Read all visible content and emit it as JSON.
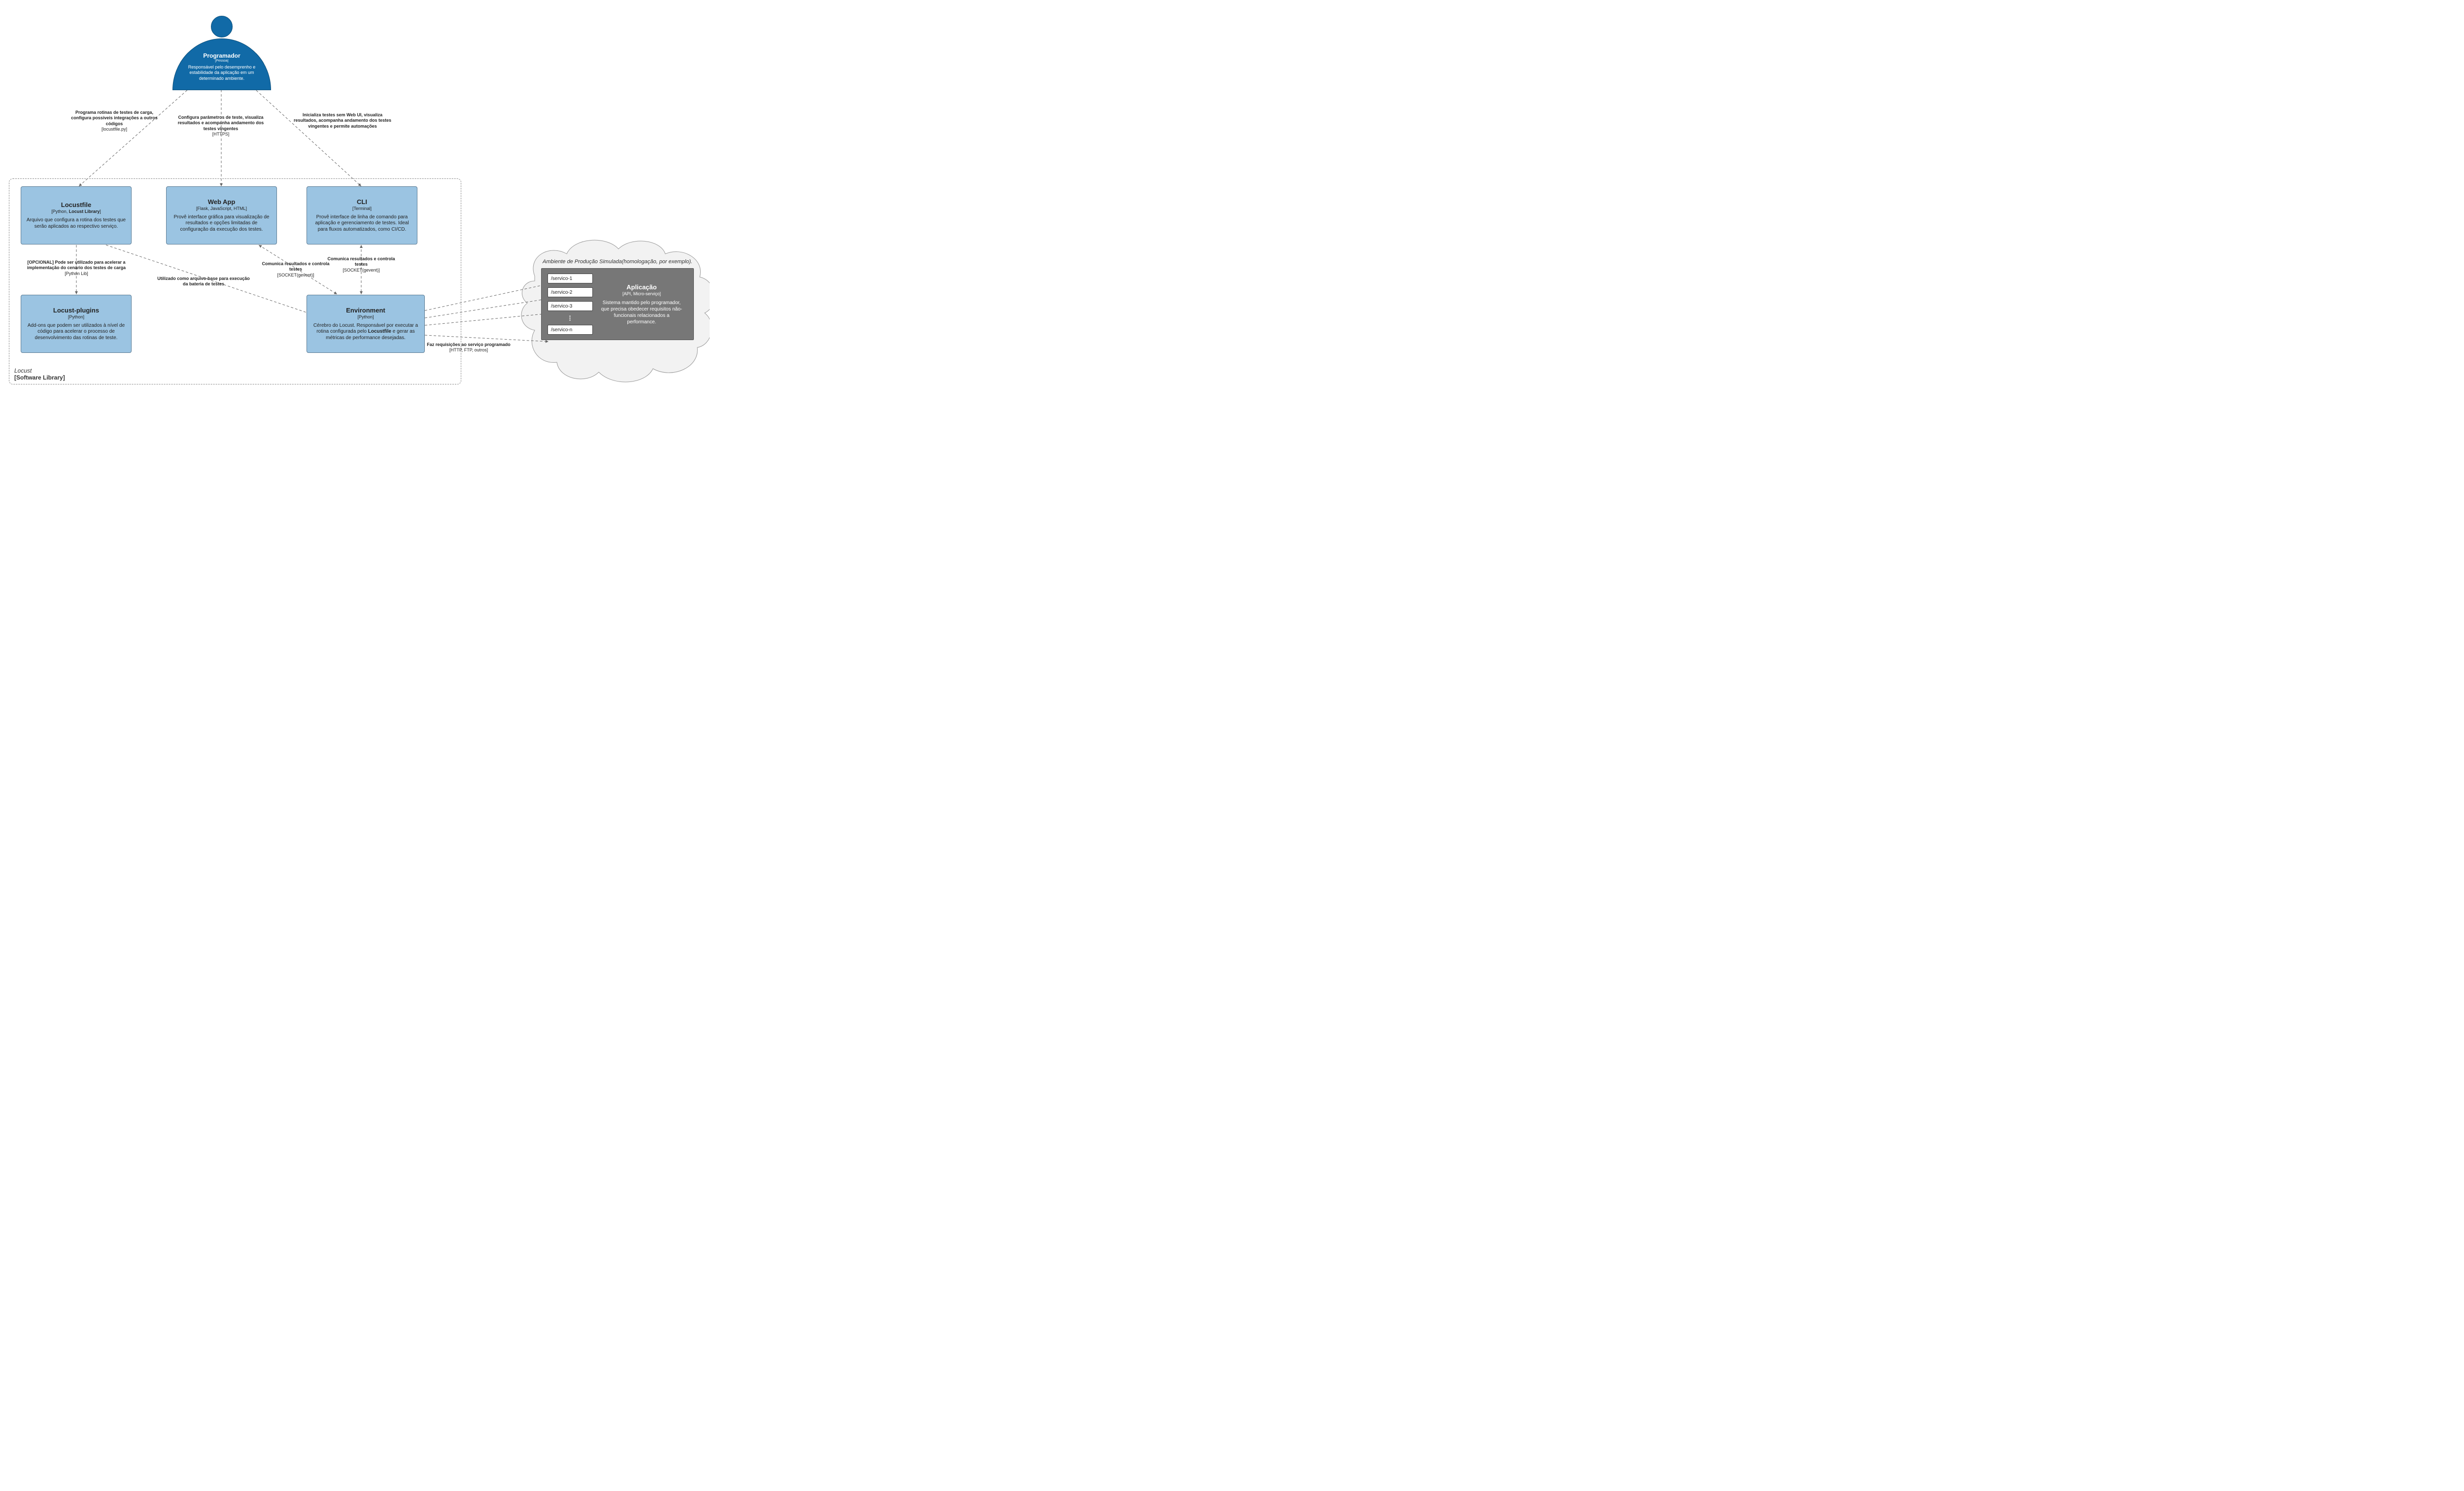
{
  "actor": {
    "title": "Programador",
    "subtitle": "[Pessoa]",
    "desc": "Responsável pelo desemprenho e estabilidade da aplicação em um determinado ambiente."
  },
  "container": {
    "name": "Locust",
    "type": "[Software Library]"
  },
  "components": {
    "locustfile": {
      "title": "Locustfile",
      "tech": "[Python, Locust Library]",
      "desc": "Arquivo que configura a rotina dos testes que serão aplicados ao respectivo serviço."
    },
    "webapp": {
      "title": "Web App",
      "tech": "[Flask, JavaScript, HTML]",
      "desc": "Provê interface gráfica para visualização de resultados e opções limitadas de configuração da execução dos testes."
    },
    "cli": {
      "title": "CLI",
      "tech": "[Terminal]",
      "desc": "Provê interface de linha de comando para aplicação e gerenciamento de testes. Ideal para fluxos automatizados, como CI/CD."
    },
    "plugins": {
      "title": "Locust-plugins",
      "tech": "[Python]",
      "desc": "Add-ons que podem ser utilizados à nível de código para acelerar o processo de desenvolvimento das rotinas de teste."
    },
    "env": {
      "title": "Environment",
      "tech": "[Python]",
      "desc_pre": "Cérebro do Locust. Responsável por executar a rotina configurada pelo ",
      "desc_bold": "Locustfile",
      "desc_post": " e gerar as métricas de performance desejadas."
    }
  },
  "edges": {
    "prog_locustfile": {
      "bold": "Programa rotinas de testes de carga, configura possíveis integrações a outros códigos",
      "sub": "[locustfile.py]"
    },
    "prog_webapp": {
      "bold": "Configura parâmetros de teste, visualiza resultados e acompanha andamento dos testes vingentes",
      "sub": "[HTTPS]"
    },
    "prog_cli": {
      "bold": "Inicializa testes sem Web UI, visualiza resultados, acompanha andamento dos testes vingentes e permite automações",
      "sub": ""
    },
    "locustfile_plugins": {
      "bold": "[OPCIONAL] Pode ser utilizado para acelerar a implementação do cenário dos testes de carga",
      "sub": "[Python Lib]"
    },
    "locustfile_env": {
      "bold": "Utilizado como arquivo-base para execução da bateria de testes",
      "sub": ""
    },
    "webapp_env": {
      "bold": "Comunica resultados e controla testes",
      "sub": "[SOCKET(gevent)]"
    },
    "cli_env": {
      "bold": "Comunica resultados e controla testes",
      "sub": "[SOCKET(gevent)]"
    },
    "env_services": {
      "bold": "Faz requisições ao serviço programado",
      "sub": "[HTTP, FTP, outros]"
    }
  },
  "cloud": {
    "caption": "Ambiente de Produção Simulada(homologação, por exemplo).",
    "endpoints": [
      "/servico-1",
      "/servico-2",
      "/servico-3",
      "/servico-n"
    ],
    "app": {
      "title": "Aplicação",
      "tech": "[API, Micro-serviço]",
      "desc": "Sistema mantido pelo programador, que precisa obedecer requisitos não-funcionais relacionados a performance."
    }
  }
}
